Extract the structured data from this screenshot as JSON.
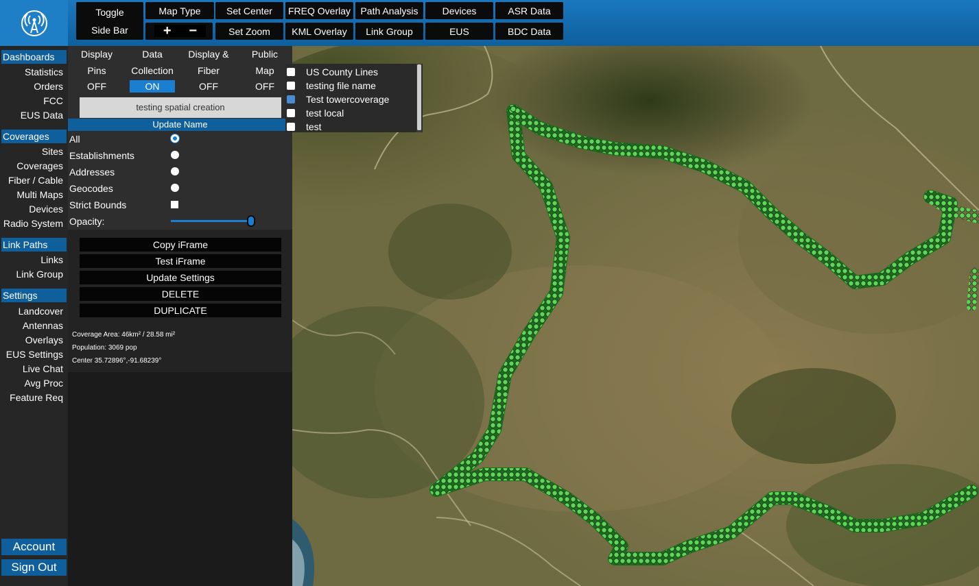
{
  "app": {
    "logo_icon": "broadcast-tower-icon",
    "brand_color": "#0f5f9d",
    "accent_color": "#1a7fd0"
  },
  "toolbar": {
    "toggle_line1": "Toggle",
    "toggle_line2": "Side Bar",
    "map_type": "Map Type",
    "zoom_in": "+",
    "zoom_out": "−",
    "set_center": "Set Center",
    "set_zoom": "Set Zoom",
    "freq_overlay": "FREQ Overlay",
    "kml_overlay": "KML Overlay",
    "path_analysis": "Path Analysis",
    "link_group": "Link Group",
    "devices": "Devices",
    "eus": "EUS",
    "asr_data": "ASR Data",
    "bdc_data": "BDC Data"
  },
  "sidebar": {
    "dashboards": {
      "header": "Dashboards",
      "items": [
        "Statistics",
        "Orders",
        "FCC",
        "EUS Data"
      ]
    },
    "coverages": {
      "header": "Coverages",
      "items": [
        "Sites",
        "Coverages",
        "Fiber / Cable",
        "Multi Maps",
        "Devices",
        "Radio System"
      ]
    },
    "link_paths": {
      "header": "Link Paths",
      "items": [
        "Links",
        "Link Group"
      ]
    },
    "settings": {
      "header": "Settings",
      "items": [
        "Landcover",
        "Antennas",
        "Overlays",
        "EUS Settings",
        "Live Chat",
        "Avg Proc",
        "Feature Req"
      ]
    },
    "account": "Account",
    "sign_out": "Sign Out"
  },
  "panel": {
    "toggles": [
      {
        "line1": "Display",
        "line2": "Pins",
        "state": "OFF"
      },
      {
        "line1": "Data",
        "line2": "Collection",
        "state": "ON"
      },
      {
        "line1": "Display &",
        "line2": "Fiber",
        "state": "OFF"
      },
      {
        "line1": "Public",
        "line2": "Map",
        "state": "OFF"
      }
    ],
    "name_value": "testing spatial creation",
    "update_name": "Update Name",
    "options": {
      "all": "All",
      "establishments": "Establishments",
      "addresses": "Addresses",
      "geocodes": "Geocodes",
      "strict_bounds": "Strict Bounds",
      "opacity": "Opacity:"
    },
    "selected_option": "All",
    "opacity_value": 1.0,
    "buttons": {
      "copy_iframe": "Copy iFrame",
      "test_iframe": "Test iFrame",
      "update_settings": "Update Settings",
      "delete": "DELETE",
      "duplicate": "DUPLICATE"
    },
    "info": {
      "coverage_area": "Coverage Area: 46km² / 28.58 mi²",
      "population": "Population: 3069 pop",
      "center": "Center 35.72896°,-91.68239°"
    }
  },
  "overlays": [
    {
      "label": "US County Lines",
      "checked": false
    },
    {
      "label": "testing file name",
      "checked": false
    },
    {
      "label": "Test towercoverage",
      "checked": true
    },
    {
      "label": "test local",
      "checked": false
    },
    {
      "label": "test",
      "checked": false
    }
  ],
  "map": {
    "type": "satellite",
    "marker_icon": "hiker-icon",
    "marker_color": "#5fd35a"
  }
}
